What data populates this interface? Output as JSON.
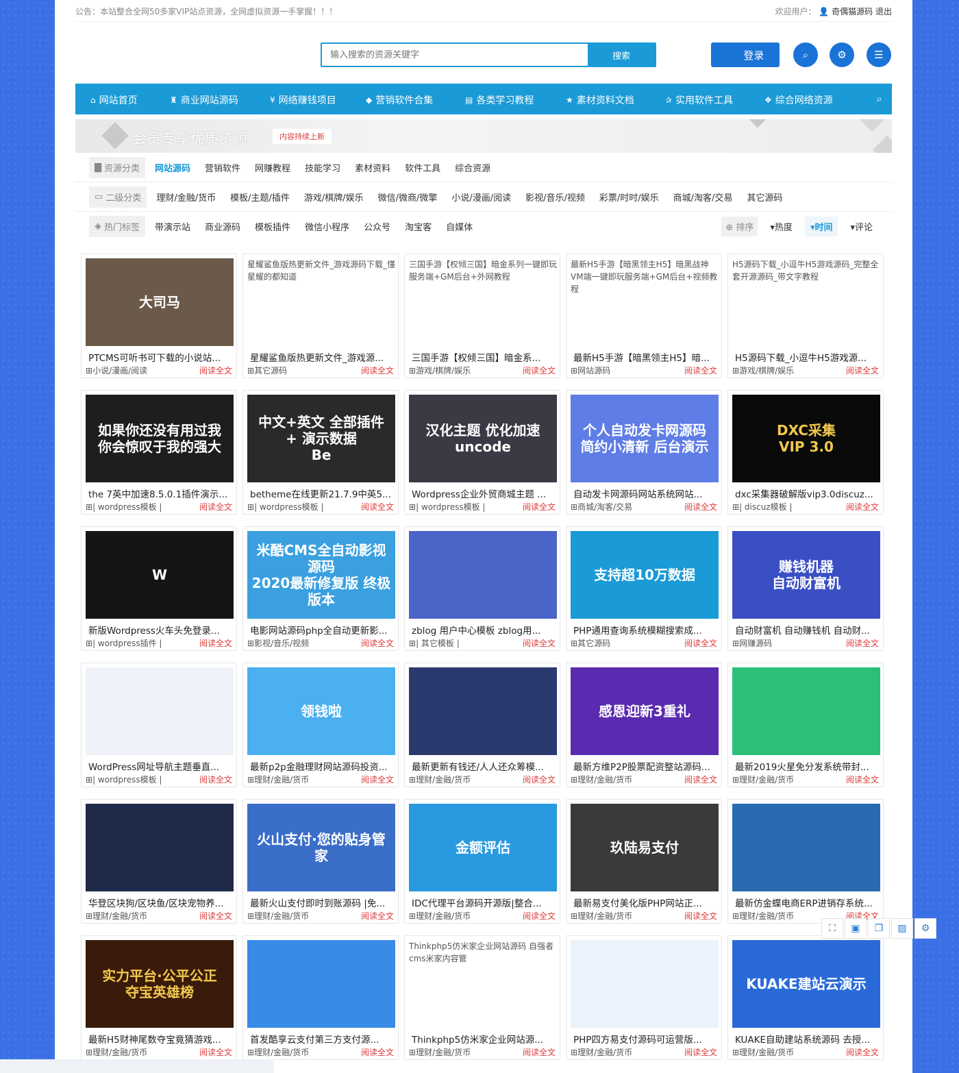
{
  "topbar": {
    "notice": "公告：本站整合全网50多家VIP站点资源，全网虚拟资源一手掌握！！！",
    "welcome_label": "欢迎用户：",
    "username": "奇偶猫源码",
    "logout": "退出"
  },
  "header": {
    "search_placeholder": "输入搜索的资源关键字",
    "search_button": "搜索",
    "login_button": "登录"
  },
  "nav": [
    {
      "label": "网站首页",
      "icon": "home-icon",
      "glyph": "⌂"
    },
    {
      "label": "商业网站源码",
      "icon": "gift-icon",
      "glyph": "♜"
    },
    {
      "label": "网络赚钱项目",
      "icon": "yen-icon",
      "glyph": "¥"
    },
    {
      "label": "营销软件合集",
      "icon": "diamond-icon",
      "glyph": "◆"
    },
    {
      "label": "各类学习教程",
      "icon": "film-icon",
      "glyph": "▤"
    },
    {
      "label": "素材资料文档",
      "icon": "star-icon",
      "glyph": "★"
    },
    {
      "label": "实用软件工具",
      "icon": "star-outline-icon",
      "glyph": "✰"
    },
    {
      "label": "综合网络资源",
      "icon": "cubes-icon",
      "glyph": "❖"
    }
  ],
  "banner": {
    "title": "会员专享优质资源",
    "tag": "内容持续上新"
  },
  "filters": {
    "category": {
      "label": "资源分类",
      "options": [
        "网站源码",
        "营销软件",
        "网赚教程",
        "技能学习",
        "素材资料",
        "软件工具",
        "综合资源"
      ],
      "active": 0
    },
    "subcategory": {
      "label": "二级分类",
      "options": [
        "理财/金融/货币",
        "模板/主题/插件",
        "游戏/棋牌/娱乐",
        "微信/微商/微擎",
        "小说/漫画/阅读",
        "影视/音乐/视频",
        "彩票/时时/娱乐",
        "商城/淘客/交易",
        "其它源码"
      ]
    },
    "tags": {
      "label": "热门标签",
      "options": [
        "带演示站",
        "商业源码",
        "模板插件",
        "微信小程序",
        "公众号",
        "淘宝客",
        "自媒体"
      ]
    },
    "sort": {
      "label": "排序",
      "options": [
        "热度",
        "时间",
        "评论"
      ],
      "active": 1
    }
  },
  "read_more": "阅读全文",
  "cards": [
    {
      "title": "PTCMS可听书可下载的小说站...",
      "cat": "小说/漫画/阅读",
      "thumb_text": "大司马",
      "bg": "#6b5a4a"
    },
    {
      "title": "星耀鲨鱼版热更新文件_游戏源...",
      "cat": "其它源码",
      "alt": "星耀鲨鱼版热更新文件_游戏源码下载_懂星耀的都知道"
    },
    {
      "title": "三国手游【权倾三国】暗金系...",
      "cat": "游戏/棋牌/娱乐",
      "alt": "三国手游【权倾三国】暗金系列一键即玩服务端+GM后台+外网教程"
    },
    {
      "title": "最新H5手游【暗黑领主H5】暗...",
      "cat": "网站源码",
      "alt": "最新H5手游【暗黑领主H5】暗黑战神VM端一键即玩服务端+GM后台+视频教程"
    },
    {
      "title": "H5源码下载_小逗牛H5游戏源...",
      "cat": "游戏/棋牌/娱乐",
      "alt": "H5源码下载_小逗牛H5游戏源码_完整全套开源源码_带文字教程"
    },
    {
      "title": "the 7英中加速8.5.0.1插件演示...",
      "cat": "| wordpress模板 |",
      "thumb_text": "如果你还没有用过我\n你会惊叹于我的强大",
      "bg": "#1e1e1e"
    },
    {
      "title": "betheme在线更新21.7.9中英5...",
      "cat": "| wordpress模板 |",
      "thumb_text": "中文+英文 全部插件 + 演示数据\nBe",
      "bg": "#2a2a2a"
    },
    {
      "title": "Wordpress企业外贸商城主题 ...",
      "cat": "| wordpress模板 |",
      "thumb_text": "汉化主题 优化加速\nuncode",
      "bg": "#3a3a44"
    },
    {
      "title": "自动发卡网源码网站系统网站...",
      "cat": "商城/淘客/交易",
      "thumb_text": "个人自动发卡网源码\n简约小清新 后台演示",
      "bg": "#5f7de6"
    },
    {
      "title": "dxc采集器破解版vip3.0discuz...",
      "cat": "| discuz模板 |",
      "thumb_text": "DXC采集\nVIP 3.0",
      "bg": "#0a0a0a",
      "fg": "#f2c94c"
    },
    {
      "title": "新版Wordpress火车头免登录...",
      "cat": "| wordpress插件 |",
      "thumb_text": "W",
      "bg": "#151515"
    },
    {
      "title": "电影网站源码php全自动更新影...",
      "cat": "影视/音乐/视频",
      "thumb_text": "米酷CMS全自动影视源码\n2020最新修复版 终极版本",
      "bg": "#3aa0e0"
    },
    {
      "title": "zblog 用户中心模板 zblog用...",
      "cat": "| 其它模板 |",
      "thumb_text": "",
      "bg": "#4a64c8"
    },
    {
      "title": "PHP通用查询系统模糊搜索成...",
      "cat": "其它源码",
      "thumb_text": "支持超10万数据",
      "bg": "#1a9ad6"
    },
    {
      "title": "自动财富机 自动赚钱机 自动财...",
      "cat": "网赚源码",
      "thumb_text": "赚钱机器\n自动财富机",
      "bg": "#3b4fc4"
    },
    {
      "title": "WordPress网址导航主题垂直...",
      "cat": "| wordpress模板 |",
      "thumb_text": "",
      "bg": "#eef2f8"
    },
    {
      "title": "最新p2p金融理财网站源码投资...",
      "cat": "理财/金融/货币",
      "thumb_text": "领钱啦",
      "bg": "#4ab0f0"
    },
    {
      "title": "最新更新有钱还/人人还众筹模...",
      "cat": "理财/金融/货币",
      "thumb_text": "",
      "bg": "#2a3a6e"
    },
    {
      "title": "最新方维P2P股票配资整站源码...",
      "cat": "理财/金融/货币",
      "thumb_text": "感恩迎新3重礼",
      "bg": "#5a2ab0"
    },
    {
      "title": "最新2019火星免分发系统带封...",
      "cat": "理财/金融/货币",
      "thumb_text": "",
      "bg": "#2bbf7a"
    },
    {
      "title": "华登区块狗/区块鱼/区块宠物养...",
      "cat": "理财/金融/货币",
      "thumb_text": "",
      "bg": "#1f2a4a"
    },
    {
      "title": "最新火山支付即时到账源码 |免...",
      "cat": "理财/金融/货币",
      "thumb_text": "火山支付·您的贴身管家",
      "bg": "#3a6ec8"
    },
    {
      "title": "IDC代理平台源码开源版|整合...",
      "cat": "理财/金融/货币",
      "thumb_text": "金额评估",
      "bg": "#2a9ae0"
    },
    {
      "title": "最新易支付美化版PHP网站正...",
      "cat": "理财/金融/货币",
      "thumb_text": "玖陆易支付",
      "bg": "#3a3a3a"
    },
    {
      "title": "最新仿金蝶电商ERP进销存系统...",
      "cat": "理财/金融/货币",
      "thumb_text": "",
      "bg": "#2a6ab0"
    },
    {
      "title": "最新H5财神尾数夺宝竟猜游戏...",
      "cat": "理财/金融/货币",
      "thumb_text": "实力平台·公平公正\n夺宝英雄榜",
      "bg": "#3a1a0a",
      "fg": "#f2c94c"
    },
    {
      "title": "首发酷享云支付第三方支付源...",
      "cat": "理财/金融/货币",
      "thumb_text": "",
      "bg": "#3a8ae8"
    },
    {
      "title": "Thinkphp5仿米家企业网站源...",
      "cat": "理财/金融/货币",
      "alt": "Thinkphp5仿米家企业网站源码 自强者cms米家内容管"
    },
    {
      "title": "PHP四方易支付源码可运营版...",
      "cat": "理财/金融/货币",
      "thumb_text": "",
      "bg": "#eaf2fb"
    },
    {
      "title": "KUAKE自助建站系统源码 去授...",
      "cat": "理财/金融/货币",
      "thumb_text": "KUAKE建站云演示",
      "bg": "#2a6ad8"
    }
  ]
}
